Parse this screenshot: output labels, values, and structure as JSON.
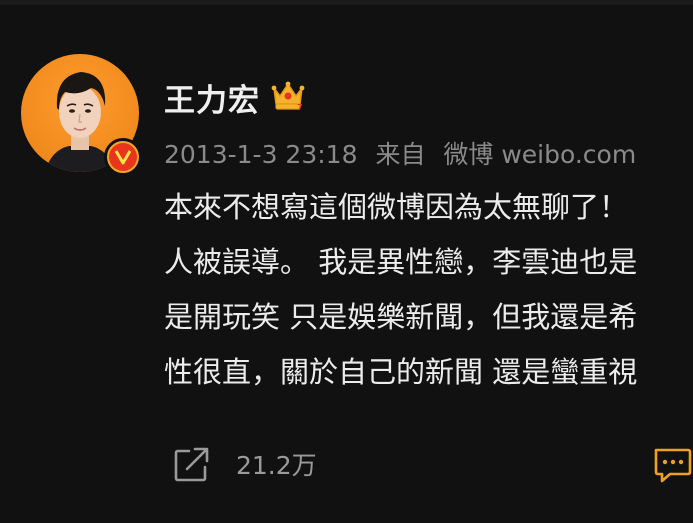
{
  "post": {
    "username": "王力宏",
    "crown_icon": "crown-icon",
    "verified_icon": "verified-badge-icon",
    "timestamp": "2013-1-3 23:18",
    "source_prefix": "来自",
    "source": "微博 weibo.com",
    "content_lines": [
      "本來不想寫這個微博因為太無聊了！",
      "人被誤導。 我是異性戀，李雲迪也是",
      "是開玩笑 只是娛樂新聞，但我還是希",
      "性很直，關於自己的新聞 還是蠻重視"
    ]
  },
  "actions": {
    "share_icon": "share-icon",
    "share_count": "21.2万",
    "comment_icon": "comment-icon"
  },
  "colors": {
    "background": "#111112",
    "text_primary": "#efefef",
    "text_secondary": "#8a8a8a",
    "accent_orange": "#f5a623",
    "comment_icon": "#f0a020"
  }
}
